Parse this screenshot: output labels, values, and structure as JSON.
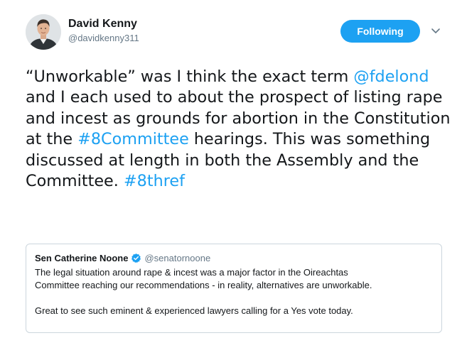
{
  "author": {
    "display_name": "David Kenny",
    "handle": "@davidkenny311",
    "avatar_icon": "person-avatar"
  },
  "follow_button": {
    "label": "Following",
    "color": "#1da1f2"
  },
  "more_menu": {
    "icon": "chevron-down-icon"
  },
  "tweet": {
    "segments": [
      {
        "text": "“Unworkable” was I think the exact term ",
        "link": false
      },
      {
        "text": "@fdelond",
        "link": true
      },
      {
        "text": " and I each used to about the prospect of listing rape and incest as grounds for abortion in the Constitution at the ",
        "link": false
      },
      {
        "text": "#8Committee",
        "link": true
      },
      {
        "text": " hearings. This was something discussed at length in both the Assembly and the Committee. ",
        "link": false
      },
      {
        "text": "#8thref",
        "link": true
      }
    ],
    "link_color": "#1da1f2"
  },
  "quoted_tweet": {
    "name": "Sen Catherine Noone",
    "verified_icon": "verified-badge-icon",
    "handle": "@senatornoone",
    "lines": [
      "The legal situation around rape & incest was a major factor in the Oireachtas",
      "Committee reaching our recommendations - in reality, alternatives are unworkable.",
      "Great to see such eminent & experienced lawyers calling for a Yes vote today."
    ]
  }
}
